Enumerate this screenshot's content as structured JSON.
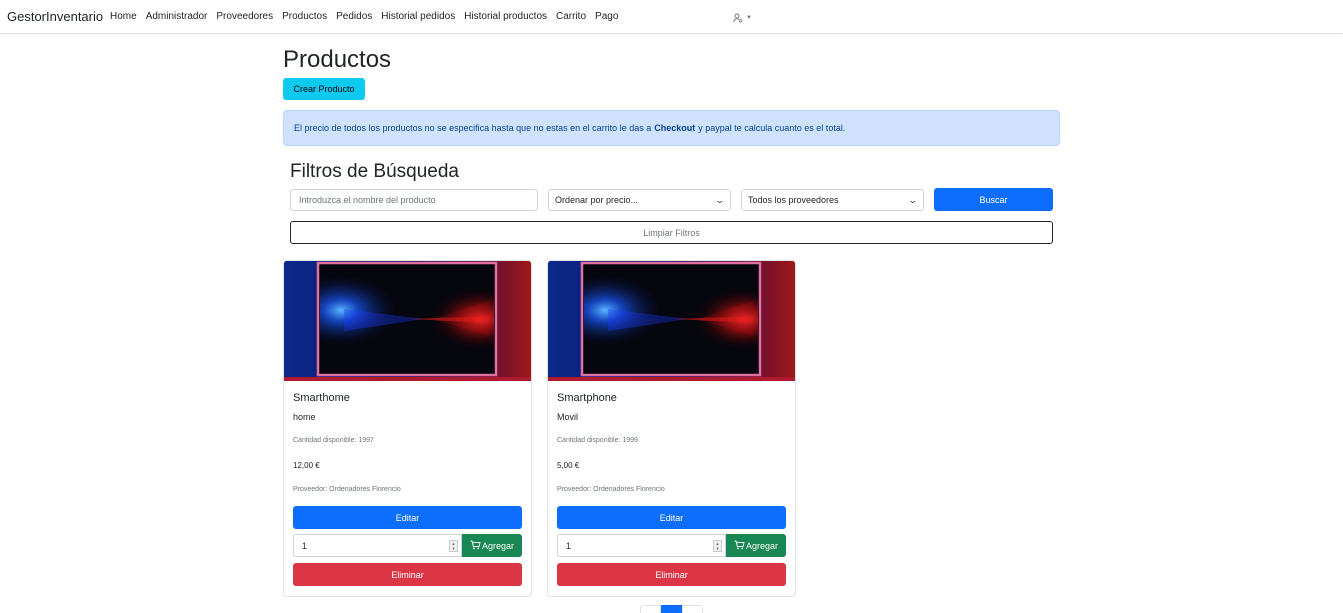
{
  "navbar": {
    "brand": "GestorInventario",
    "links": [
      "Home",
      "Administrador",
      "Proveedores",
      "Productos",
      "Pedidos",
      "Historial pedidos",
      "Historial productos",
      "Carrito",
      "Pago"
    ],
    "user_icon": "user-gear-icon",
    "caret_icon": "caret-down-icon"
  },
  "page": {
    "title": "Productos",
    "create_button": "Crear Producto"
  },
  "alert": {
    "text_before": "El precio de todos los productos no se especifica hasta que no estas en el carrito le das a",
    "text_bold": "Checkout",
    "text_after": "y paypal te calcula cuanto es el total."
  },
  "filters": {
    "title": "Filtros de Búsqueda",
    "name_placeholder": "Introduzca el nombre del producto",
    "price_select": "Ordenar por precio...",
    "provider_select": "Todos los proveedores",
    "search_button": "Buscar",
    "clear_button": "Limpiar Filtros"
  },
  "products": [
    {
      "name": "Smarthome",
      "category": "home",
      "quantity": "Cantidad disponible: 1997",
      "price": "12,00 €",
      "provider": "Proveedor: Ordenadores Florencio",
      "edit_label": "Editar",
      "qty_value": "1",
      "add_label": "Agregar",
      "delete_label": "Eliminar",
      "image_icon": "tv-image"
    },
    {
      "name": "Smartphone",
      "category": "Movil",
      "quantity": "Cantidad disponible: 1999",
      "price": "5,00 €",
      "provider": "Proveedor: Ordenadores Florencio",
      "edit_label": "Editar",
      "qty_value": "1",
      "add_label": "Agregar",
      "delete_label": "Eliminar",
      "image_icon": "tv-image"
    }
  ],
  "pagination": {
    "current": ""
  },
  "colors": {
    "primary": "#0d6efd",
    "info": "#0dcaf0",
    "success": "#198754",
    "danger": "#dc3545",
    "alert_bg": "#cfe2ff",
    "alert_text": "#084298"
  }
}
